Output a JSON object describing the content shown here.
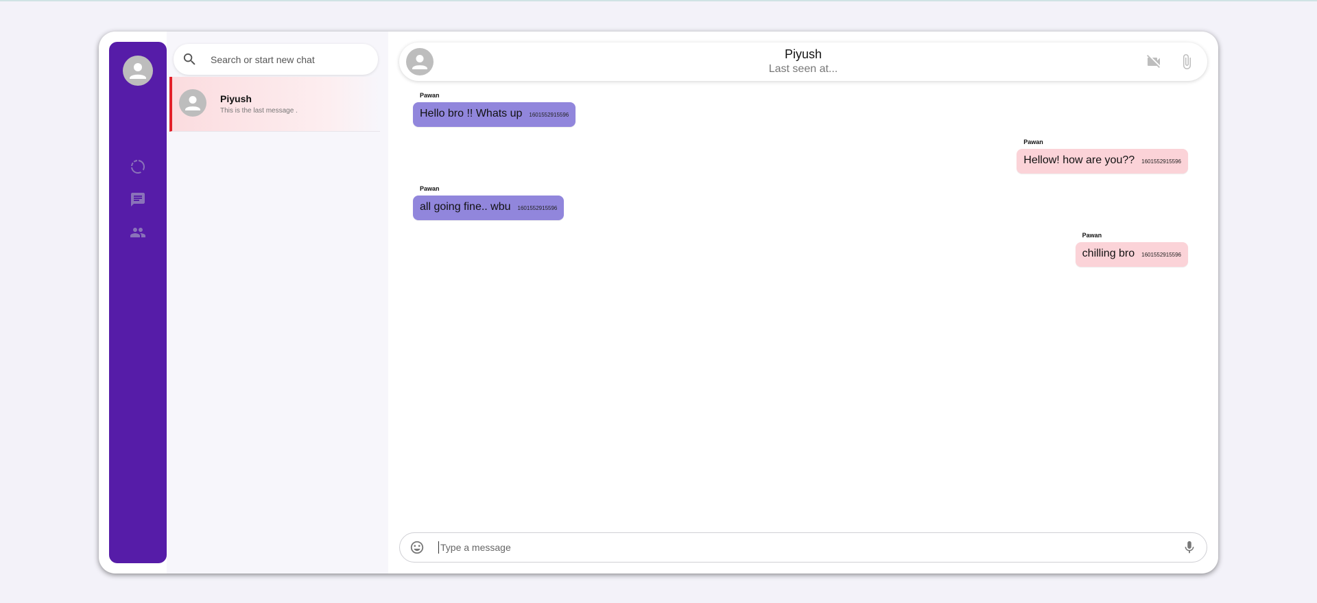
{
  "sidebar": {
    "nav_icons": [
      "status-icon",
      "chats-icon",
      "contacts-icon"
    ]
  },
  "search": {
    "placeholder": "Search or start new chat"
  },
  "chat_list": [
    {
      "name": "Piyush",
      "last_message": "This is the last message ."
    }
  ],
  "header": {
    "name": "Piyush",
    "status": "Last seen at..."
  },
  "messages": [
    {
      "sender": "Pawan",
      "text": "Hello bro !! Whats up",
      "time": "1601552915596",
      "direction": "incoming"
    },
    {
      "sender": "Pawan",
      "text": "Hellow! how are you??",
      "time": "1601552915596",
      "direction": "outgoing"
    },
    {
      "sender": "Pawan",
      "text": "all going fine.. wbu",
      "time": "1601552915596",
      "direction": "incoming"
    },
    {
      "sender": "Pawan",
      "text": "chilling bro",
      "time": "1601552915596",
      "direction": "outgoing"
    }
  ],
  "composer": {
    "placeholder": "Type a message"
  },
  "colors": {
    "rail": "#561ca8",
    "incoming_bubble": "#9186dc",
    "outgoing_bubble": "#fbd3d8",
    "active_chat_bar": "#e3202a",
    "icon_muted": "#8a73b9"
  }
}
